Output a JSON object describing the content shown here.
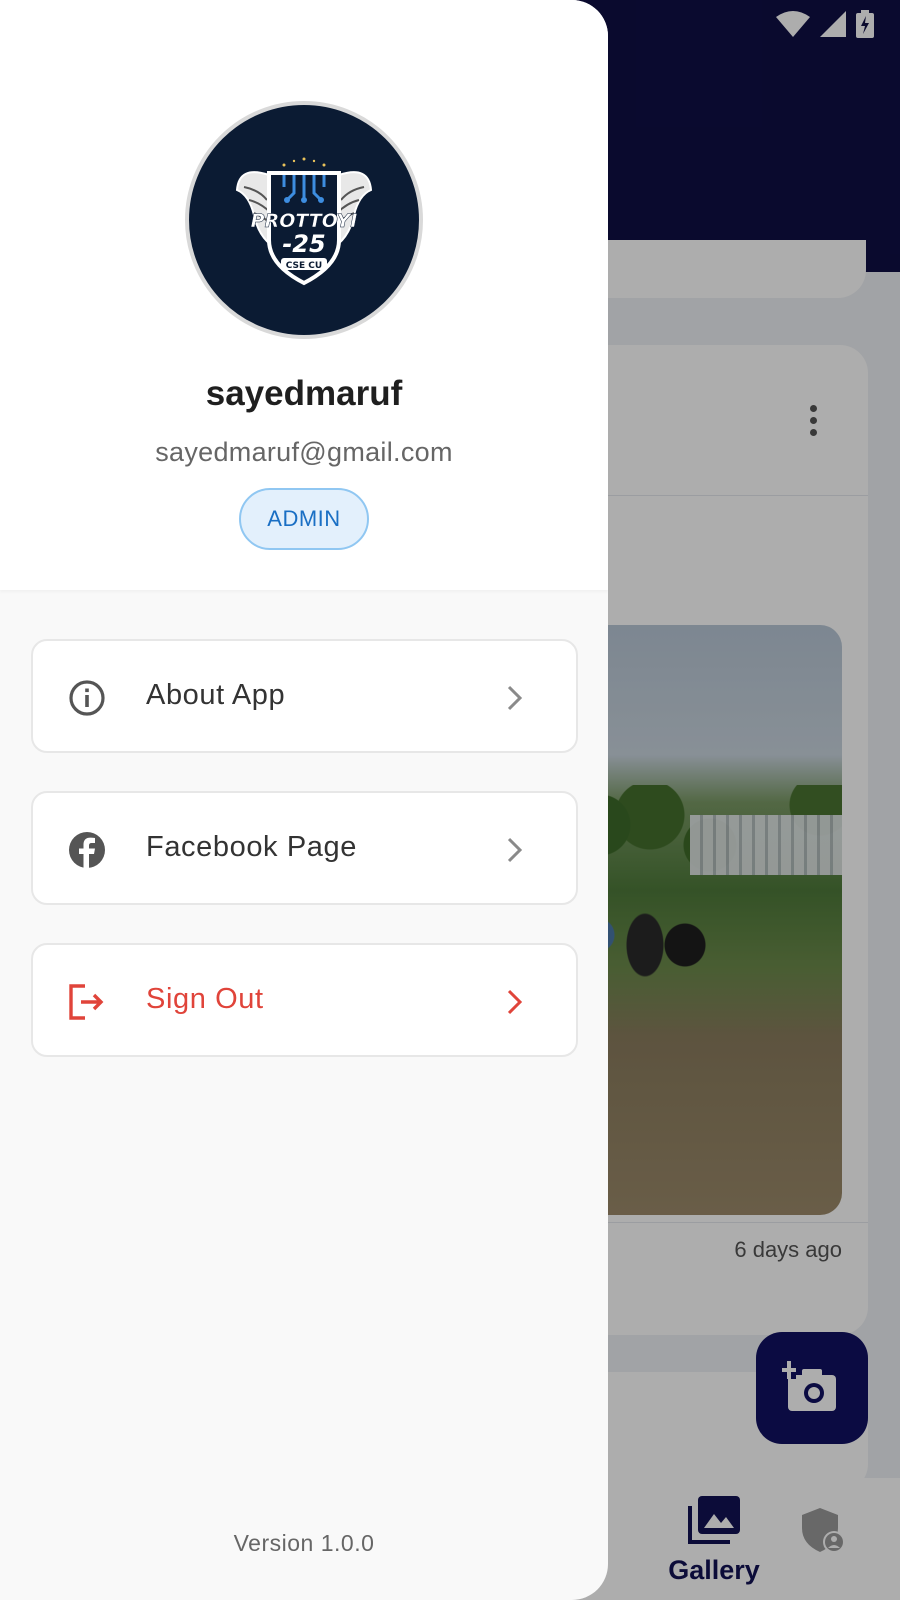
{
  "drawer": {
    "profile": {
      "username": "sayedmaruf",
      "email": "sayedmaruf@gmail.com",
      "role": "ADMIN",
      "avatar_logo_lines": [
        "PROTTOYI",
        "-25",
        "CSE CU"
      ]
    },
    "menu": [
      {
        "label": "About App",
        "icon": "info-icon"
      },
      {
        "label": "Facebook Page",
        "icon": "facebook-icon"
      },
      {
        "label": "Sign Out",
        "icon": "sign-out-icon",
        "color": "#e0443a"
      }
    ],
    "version": "Version 1.0.0"
  },
  "background": {
    "post_time": "6 days ago",
    "bottom_nav": {
      "active_label": "Gallery"
    },
    "fab_icon": "add-photo-icon"
  },
  "colors": {
    "header": "#0f0f45",
    "accent": "#111162",
    "badge_text": "#1a6fc4",
    "badge_bg": "#e3f0fc",
    "danger": "#e0443a"
  }
}
